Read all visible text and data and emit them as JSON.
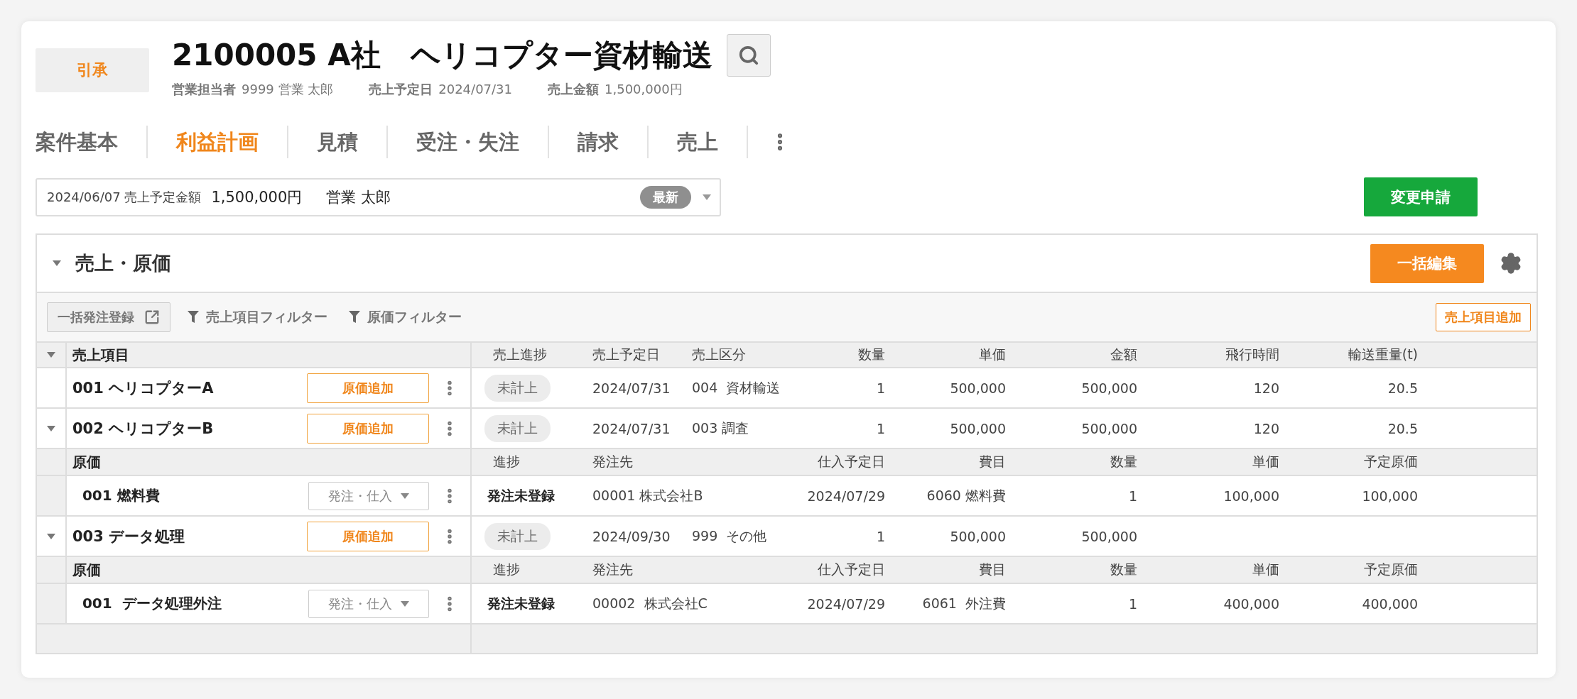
{
  "header": {
    "tag_button": "引承",
    "title": "2100005 A社　ヘリコプター資材輸送",
    "meta": [
      {
        "label": "営業担当者",
        "value": "9999 営業 太郎"
      },
      {
        "label": "売上予定日",
        "value": "2024/07/31"
      },
      {
        "label": "売上金額",
        "value": "1,500,000円"
      }
    ]
  },
  "tabs": [
    {
      "label": "案件基本",
      "selected": false
    },
    {
      "label": "利益計画",
      "selected": true
    },
    {
      "label": "見積",
      "selected": false
    },
    {
      "label": "受注・失注",
      "selected": false
    },
    {
      "label": "請求",
      "selected": false
    },
    {
      "label": "売上",
      "selected": false
    }
  ],
  "version_select": {
    "date_label": "2024/06/07 売上予定金額",
    "amount": "1,500,000円",
    "person": "営業 太郎",
    "badge": "最新"
  },
  "apply_button": "変更申請",
  "section": {
    "title": "売上・原価",
    "expanded": true,
    "edit_button": "一括編集",
    "toolbar": {
      "bulk_order_button": "一括発注登録",
      "filters": [
        "売上項目フィルター",
        "原価フィルター"
      ],
      "add_button": "売上項目追加"
    },
    "sales_header": {
      "item": "売上項目",
      "columns": [
        "売上進捗",
        "売上予定日",
        "売上区分",
        "数量",
        "単価",
        "金額",
        "飛行時間",
        "輸送重量(t)"
      ]
    },
    "rows": [
      {
        "name": "001 ヘリコプターA",
        "add_cost_button": "原価追加",
        "status": "未計上",
        "date": "2024/07/31",
        "category": "004  資材輸送",
        "qty": "1",
        "price": "500,000",
        "amount": "500,000",
        "flight_time": "120",
        "weight": "20.5"
      },
      {
        "name": "002 ヘリコプターB",
        "add_cost_button": "原価追加",
        "status": "未計上",
        "date": "2024/07/31",
        "category": "003 調査",
        "qty": "1",
        "price": "500,000",
        "amount": "500,000",
        "flight_time": "120",
        "weight": "20.5",
        "expanded": true,
        "cost_header": {
          "item": "原価",
          "columns": [
            "進捗",
            "発注先",
            "仕入予定日",
            "費目",
            "数量",
            "単価",
            "予定原価"
          ]
        },
        "costs": [
          {
            "name": "001 燃料費",
            "action": "発注・仕入",
            "status": "発注未登録",
            "supplier": "00001 株式会社B",
            "date": "2024/07/29",
            "account": "6060 燃料費",
            "qty": "1",
            "price": "100,000",
            "planned_cost": "100,000"
          }
        ]
      },
      {
        "name": "003 データ処理",
        "add_cost_button": "原価追加",
        "status": "未計上",
        "date": "2024/09/30",
        "category": "999  その他",
        "qty": "1",
        "price": "500,000",
        "amount": "500,000",
        "expanded": true,
        "cost_header": {
          "item": "原価",
          "columns": [
            "進捗",
            "発注先",
            "仕入予定日",
            "費目",
            "数量",
            "単価",
            "予定原価"
          ]
        },
        "costs": [
          {
            "name": "001  データ処理外注",
            "action": "発注・仕入",
            "status": "発注未登録",
            "supplier": "00002  株式会社C",
            "date": "2024/07/29",
            "account": "6061  外注費",
            "qty": "1",
            "price": "400,000",
            "planned_cost": "400,000"
          }
        ]
      }
    ]
  }
}
